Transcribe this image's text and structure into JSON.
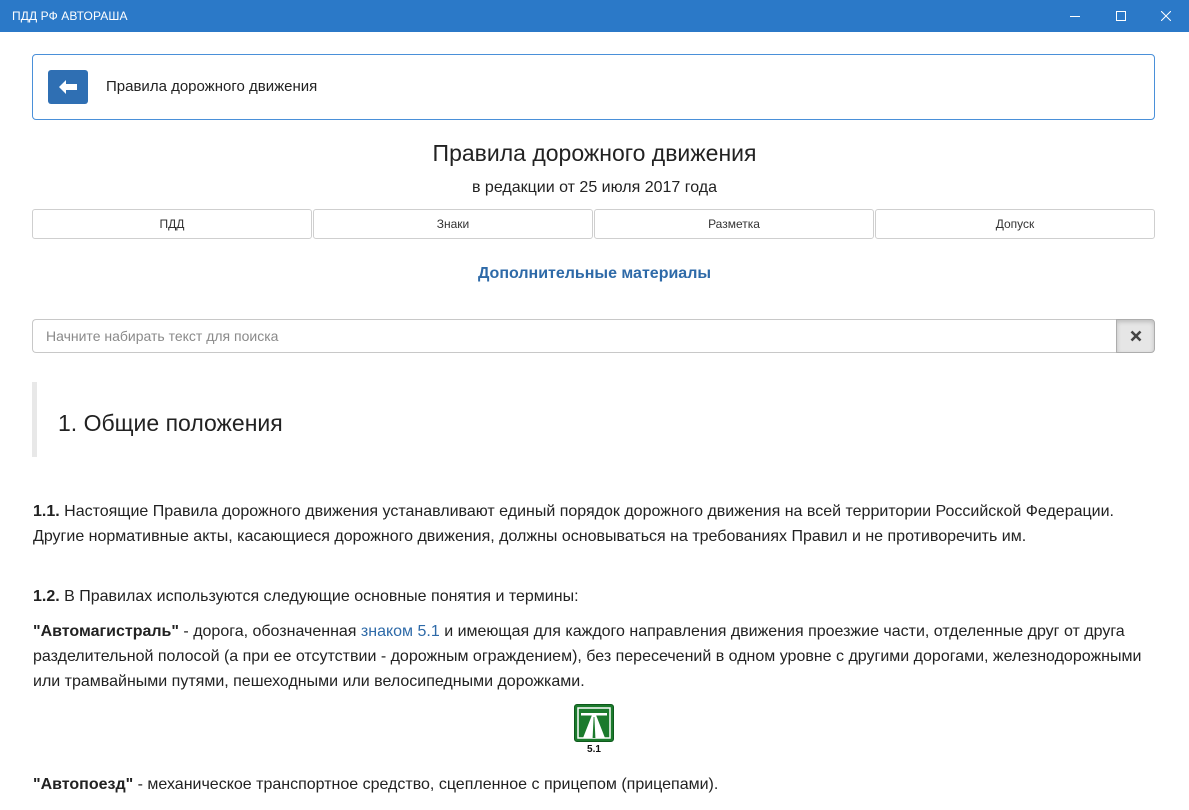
{
  "window": {
    "title": "ПДД РФ АВТОРАША"
  },
  "header": {
    "title": "Правила дорожного движения"
  },
  "document": {
    "title": "Правила дорожного движения",
    "subtitle": "в редакции от 25 июля 2017 года"
  },
  "tabs": [
    {
      "label": "ПДД"
    },
    {
      "label": "Знаки"
    },
    {
      "label": "Разметка"
    },
    {
      "label": "Допуск"
    }
  ],
  "extra_link": "Дополнительные материалы",
  "search": {
    "placeholder": "Начните набирать текст для поиска",
    "value": ""
  },
  "section": {
    "title": "1. Общие положения"
  },
  "paragraphs": {
    "p1_num": "1.1.",
    "p1_text": " Настоящие Правила дорожного движения устанавливают единый порядок дорожного движения на всей территории Российской Федерации. Другие нормативные акты, касающиеся дорожного движения, должны основываться на требованиях Правил и не противоречить им.",
    "p2_num": "1.2.",
    "p2_text": " В Правилах используются следующие основные понятия и термины:",
    "p3_term": "\"Автомагистраль\"",
    "p3_before": " - дорога, обозначенная ",
    "p3_link": "знаком 5.1",
    "p3_after": " и имеющая для каждого направления движения проезжие части, отделенные друг от друга разделительной полосой (а при ее отсутствии - дорожным ограждением), без пересечений в одном уровне с другими дорогами, железнодорожными или трамвайными путями, пешеходными или велосипедными дорожками.",
    "p4_term": "\"Автопоезд\"",
    "p4_text": " - механическое транспортное средство, сцепленное с прицепом (прицепами)."
  },
  "sign": {
    "caption": "5.1",
    "icon": "motorway-sign-icon",
    "color": "#1b7a2c"
  }
}
